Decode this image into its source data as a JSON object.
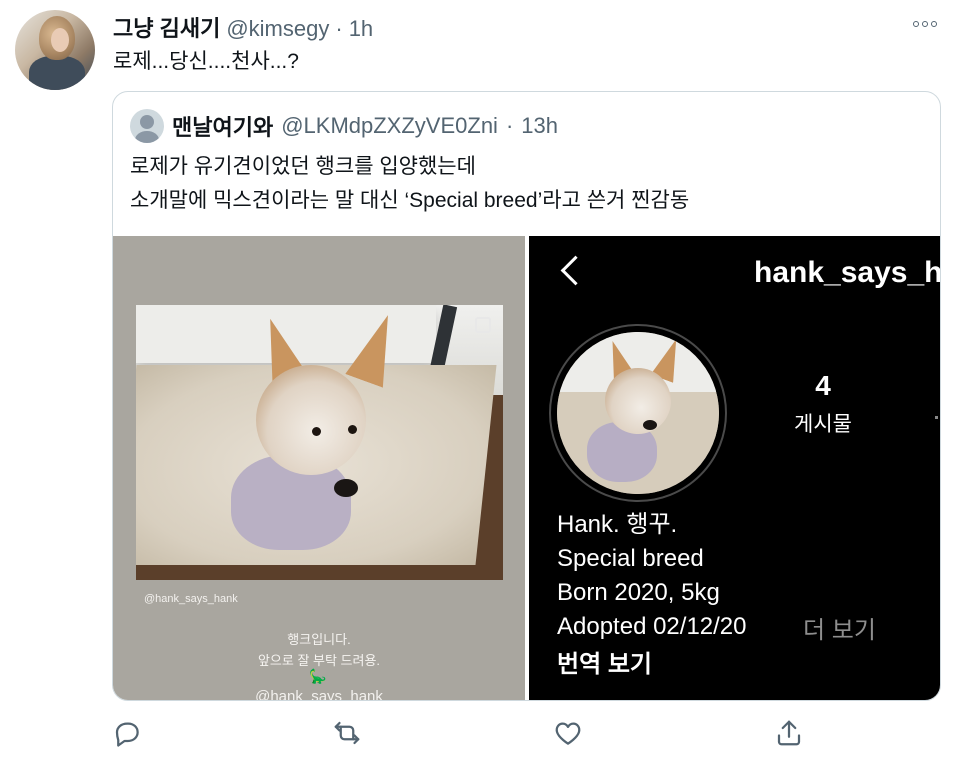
{
  "tweet": {
    "display_name": "그냥 김새기",
    "handle": "@kimsegy",
    "separator": "·",
    "time": "1h",
    "text": "로제...당신....천사...?"
  },
  "quoted": {
    "display_name": "맨날여기와",
    "handle": "@LKMdpZXZyVE0Zni",
    "separator": "·",
    "time": "13h",
    "line1": "로제가 유기견이었던 행크를 입양했는데",
    "line2": "소개말에 믹스견이라는 말 대신 ‘Special breed’라고 쓴거 찐감동"
  },
  "story": {
    "tag": "@hank_says_hank",
    "line1": "행크입니다.",
    "line2": "앞으로 잘 부탁 드려용.",
    "emoji": "🦕",
    "tag2": "@hank_says_hank"
  },
  "profile": {
    "username": "hank_says_h",
    "post_count": "4",
    "post_label": "게시물",
    "bio": [
      "Hank. 행꾸.",
      "Special breed",
      "Born 2020, 5kg",
      "Adopted 02/12/20"
    ],
    "more": "더 보기",
    "translate": "번역 보기"
  },
  "icons": {
    "reply": "reply-icon",
    "retweet": "retweet-icon",
    "like": "heart-icon",
    "share": "share-icon",
    "more": "more-icon",
    "back": "back-icon"
  },
  "colors": {
    "secondary_text": "#536471",
    "border": "#cfd9de"
  }
}
